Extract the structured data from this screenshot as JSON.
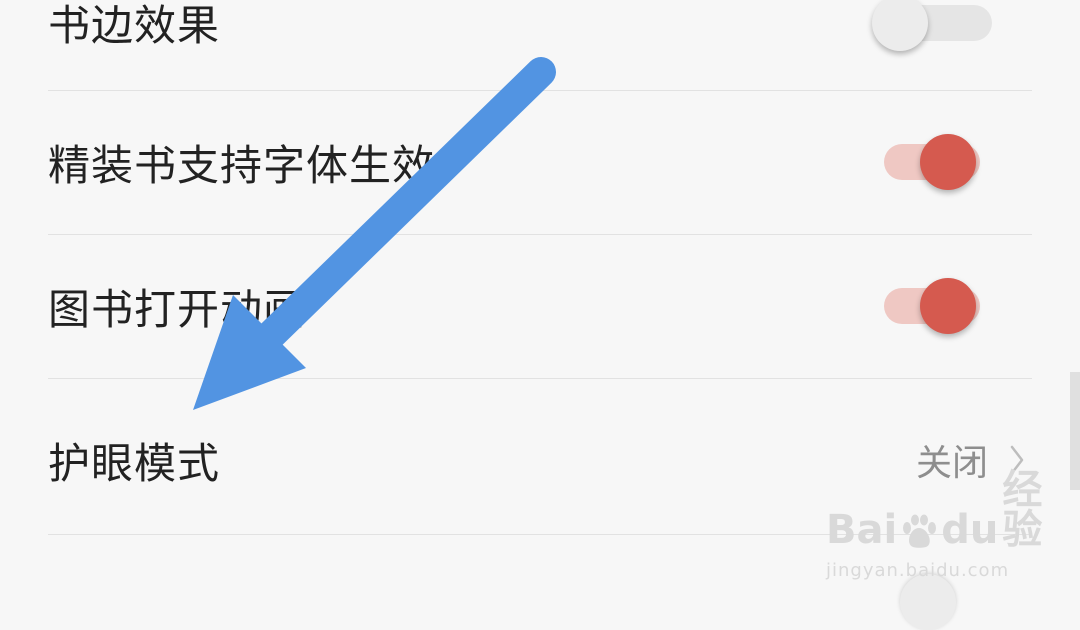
{
  "settings": {
    "items": [
      {
        "label": "书边效果",
        "control": "toggle",
        "state": "off"
      },
      {
        "label": "精装书支持字体生效",
        "control": "toggle",
        "state": "on"
      },
      {
        "label": "图书打开动画",
        "control": "toggle",
        "state": "on"
      },
      {
        "label": "护眼模式",
        "control": "value",
        "value": "关闭"
      }
    ]
  },
  "colors": {
    "toggle_on_knob": "#d55a4f",
    "toggle_on_track": "#efc8c3",
    "toggle_off_knob": "#ececec",
    "annotation_arrow": "#5294e2"
  },
  "icons": {
    "chevron": "chevron-right-icon",
    "arrow": "annotation-arrow-icon",
    "watermark_logo": "baidu-paw-icon"
  },
  "watermark": {
    "brand_latin": "Bai",
    "brand_suffix": "du",
    "brand_cn": "经验",
    "url": "jingyan.baidu.com"
  }
}
